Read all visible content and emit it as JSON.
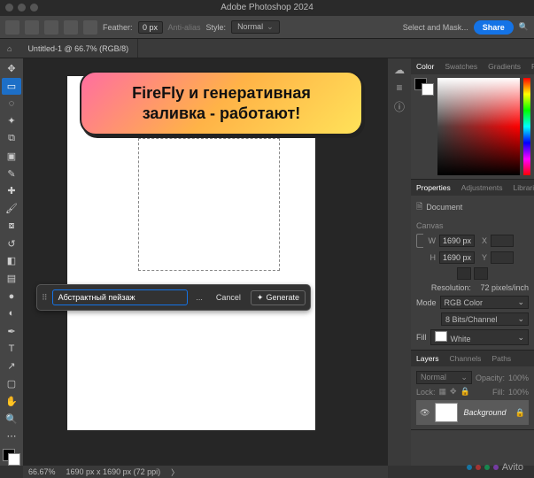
{
  "app_title": "Adobe Photoshop 2024",
  "optionsbar": {
    "feather_label": "Feather:",
    "feather_value": "0 px",
    "antialias_label": "Anti-alias",
    "style_label": "Style:",
    "style_value": "Normal",
    "selectmask": "Select and Mask...",
    "share": "Share"
  },
  "doc_tab": "Untitled-1 @ 66.7% (RGB/8)",
  "genfill": {
    "prompt": "Абстрактный пейзаж",
    "more": "...",
    "cancel": "Cancel",
    "generate": "Generate"
  },
  "color_tabs": [
    "Color",
    "Swatches",
    "Gradients",
    "Patterns"
  ],
  "props_tabs": [
    "Properties",
    "Adjustments",
    "Libraries"
  ],
  "properties": {
    "doc_label": "Document",
    "canvas_label": "Canvas",
    "w_label": "W",
    "h_label": "H",
    "x_label": "X",
    "y_label": "Y",
    "w": "1690 px",
    "h": "1690 px",
    "res_label": "Resolution:",
    "res": "72 pixels/inch",
    "mode_label": "Mode",
    "mode": "RGB Color",
    "bits": "8 Bits/Channel",
    "fill_label": "Fill",
    "fill": "White"
  },
  "layer_tabs": [
    "Layers",
    "Channels",
    "Paths"
  ],
  "layers": {
    "blend": "Normal",
    "opacity_label": "Opacity:",
    "opacity": "100%",
    "lock_label": "Lock:",
    "fill_label": "Fill:",
    "fill": "100%",
    "bg_name": "Background"
  },
  "status": {
    "zoom": "66.67%",
    "dims": "1690 px x 1690 px (72 ppi)"
  },
  "callout": "FireFly и генеративная заливка - работают!",
  "watermark": "Avito"
}
